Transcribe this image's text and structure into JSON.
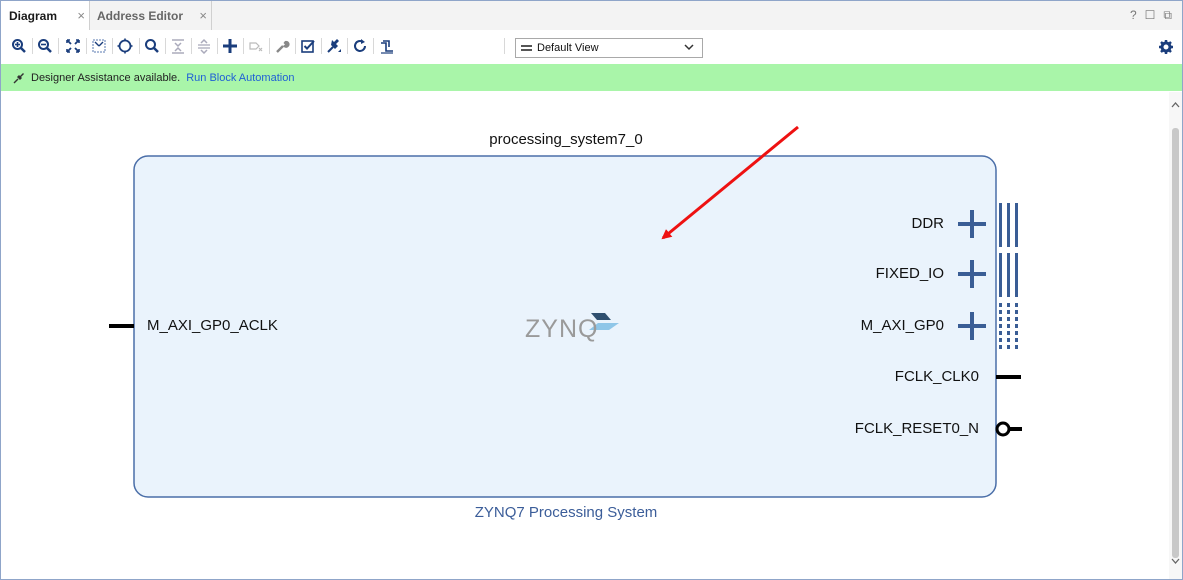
{
  "tabs": [
    {
      "label": "Diagram",
      "active": true
    },
    {
      "label": "Address Editor",
      "active": false
    }
  ],
  "window_controls": [
    "?",
    "restore",
    "maximize"
  ],
  "toolbar": {
    "icons": [
      "zoom-in-icon",
      "zoom-out-icon",
      "fit-view-icon",
      "fit-selection-icon",
      "auto-fit-icon",
      "search-icon",
      "collapse-all-icon",
      "expand-all-icon",
      "add-ip-icon",
      "make-external-icon",
      "properties-icon",
      "validate-design-icon",
      "run-connection-automation-icon",
      "regenerate-layout-icon",
      "optimize-routing-icon"
    ],
    "view_select": "Default View"
  },
  "assist": {
    "message": "Designer Assistance available.",
    "link": "Run Block Automation"
  },
  "block": {
    "instance_name": "processing_system7_0",
    "type_name": "ZYNQ7 Processing System",
    "logo_text": "ZYNQ",
    "left_ports": [
      "M_AXI_GP0_ACLK"
    ],
    "right_ports": [
      "DDR",
      "FIXED_IO",
      "M_AXI_GP0",
      "FCLK_CLK0",
      "FCLK_RESET0_N"
    ]
  },
  "colors": {
    "block_fill": "#eaf3fc",
    "block_border": "#4a6ea8",
    "interface_blue": "#3a5d95",
    "assist_green": "#a9f5a9",
    "link_blue": "#1f5fd6",
    "arrow_red": "#ee1111"
  }
}
